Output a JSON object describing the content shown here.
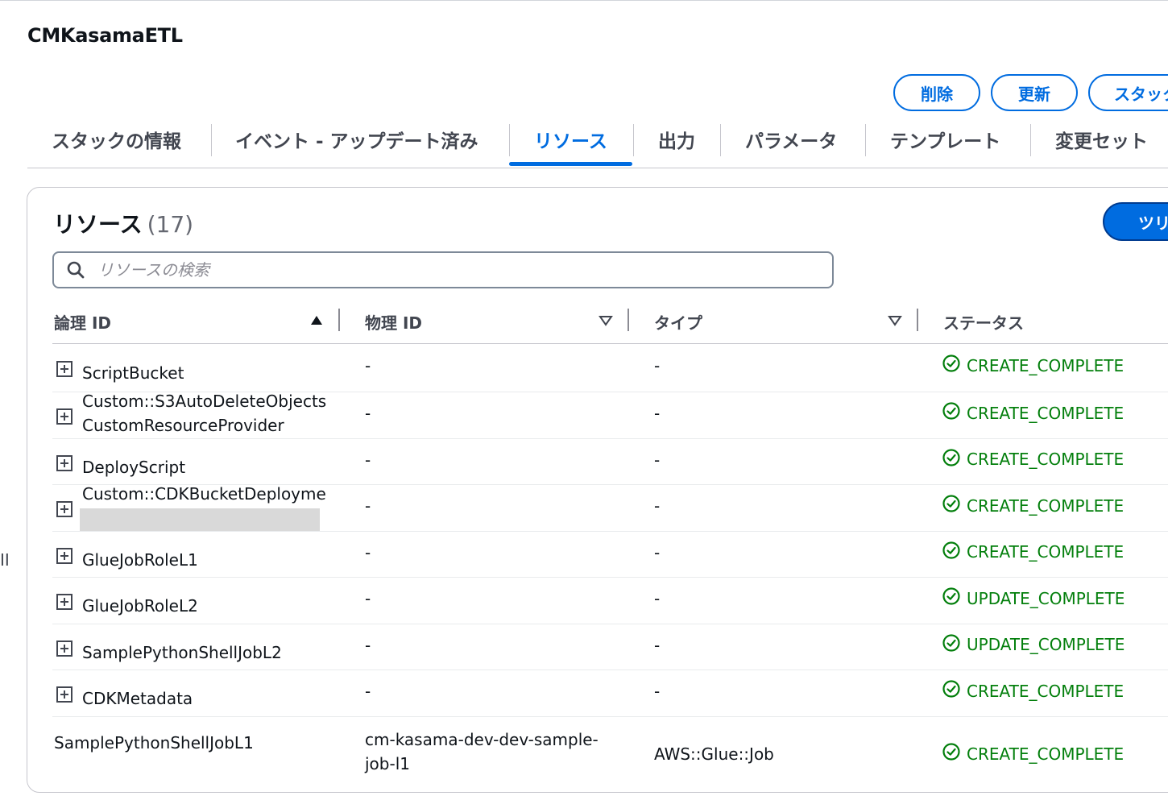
{
  "stack": {
    "title": "CMKasamaETL"
  },
  "actions": {
    "delete": "削除",
    "update": "更新",
    "stack_actions": "スタック"
  },
  "tabs": [
    "スタックの情報",
    "イベント - アップデート済み",
    "リソース",
    "出力",
    "パラメータ",
    "テンプレート",
    "変更セット"
  ],
  "panel": {
    "title": "リソース",
    "count": "(17)",
    "tree_button": "ツリ",
    "search_placeholder": "リソースの検索"
  },
  "columns": [
    "論理 ID",
    "物理 ID",
    "タイプ",
    "ステータス"
  ],
  "rows": [
    {
      "logical_1": "ScriptBucket",
      "logical_2": "",
      "physical": "-",
      "physical_2": "",
      "type": "-",
      "status": "CREATE_COMPLETE"
    },
    {
      "logical_1": "Custom::S3AutoDeleteObjects",
      "logical_2": "CustomResourceProvider",
      "physical": "-",
      "physical_2": "",
      "type": "-",
      "status": "CREATE_COMPLETE"
    },
    {
      "logical_1": "DeployScript",
      "logical_2": "",
      "physical": "-",
      "physical_2": "",
      "type": "-",
      "status": "CREATE_COMPLETE"
    },
    {
      "logical_1": "Custom::CDKBucketDeployme",
      "logical_2": "",
      "physical": "-",
      "physical_2": "",
      "type": "-",
      "status": "CREATE_COMPLETE"
    },
    {
      "logical_1": "GlueJobRoleL1",
      "logical_2": "",
      "physical": "-",
      "physical_2": "",
      "type": "-",
      "status": "CREATE_COMPLETE"
    },
    {
      "logical_1": "GlueJobRoleL2",
      "logical_2": "",
      "physical": "-",
      "physical_2": "",
      "type": "-",
      "status": "UPDATE_COMPLETE"
    },
    {
      "logical_1": "SamplePythonShellJobL2",
      "logical_2": "",
      "physical": "-",
      "physical_2": "",
      "type": "-",
      "status": "UPDATE_COMPLETE"
    },
    {
      "logical_1": "CDKMetadata",
      "logical_2": "",
      "physical": "-",
      "physical_2": "",
      "type": "-",
      "status": "CREATE_COMPLETE"
    },
    {
      "logical_1": "SamplePythonShellJobL1",
      "logical_2": "",
      "physical": "cm-kasama-dev-dev-sample-",
      "physical_2": "job-l1",
      "type": "AWS::Glue::Job",
      "status": "CREATE_COMPLETE"
    }
  ],
  "side_handle": "II"
}
